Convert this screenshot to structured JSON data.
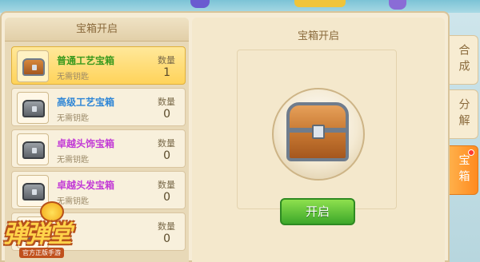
{
  "left_panel": {
    "title": "宝箱开启",
    "items": [
      {
        "name": "普通工艺宝箱",
        "sub": "无需钥匙",
        "qty_label": "数量",
        "qty": "1",
        "name_color": "#3a9a1e",
        "selected": true
      },
      {
        "name": "高级工艺宝箱",
        "sub": "无需钥匙",
        "qty_label": "数量",
        "qty": "0",
        "name_color": "#2f86d6",
        "selected": false
      },
      {
        "name": "卓越头饰宝箱",
        "sub": "无需钥匙",
        "qty_label": "数量",
        "qty": "0",
        "name_color": "#c23ad6",
        "selected": false
      },
      {
        "name": "卓越头发宝箱",
        "sub": "无需钥匙",
        "qty_label": "数量",
        "qty": "0",
        "name_color": "#c23ad6",
        "selected": false
      },
      {
        "name": "",
        "sub": "",
        "qty_label": "数量",
        "qty": "0",
        "name_color": "#c23ad6",
        "selected": false
      }
    ]
  },
  "right_panel": {
    "title": "宝箱开启",
    "open_button": "开启"
  },
  "side_tabs": [
    {
      "label": "合成",
      "active": false
    },
    {
      "label": "分解",
      "active": false
    },
    {
      "label": "宝箱",
      "active": true
    }
  ],
  "logo": {
    "title": "弹弹堂",
    "subtitle": "官方正版手游"
  },
  "icons": {
    "chest_gold": "treasure-chest-icon",
    "chest_silver": "treasure-chest-icon"
  }
}
